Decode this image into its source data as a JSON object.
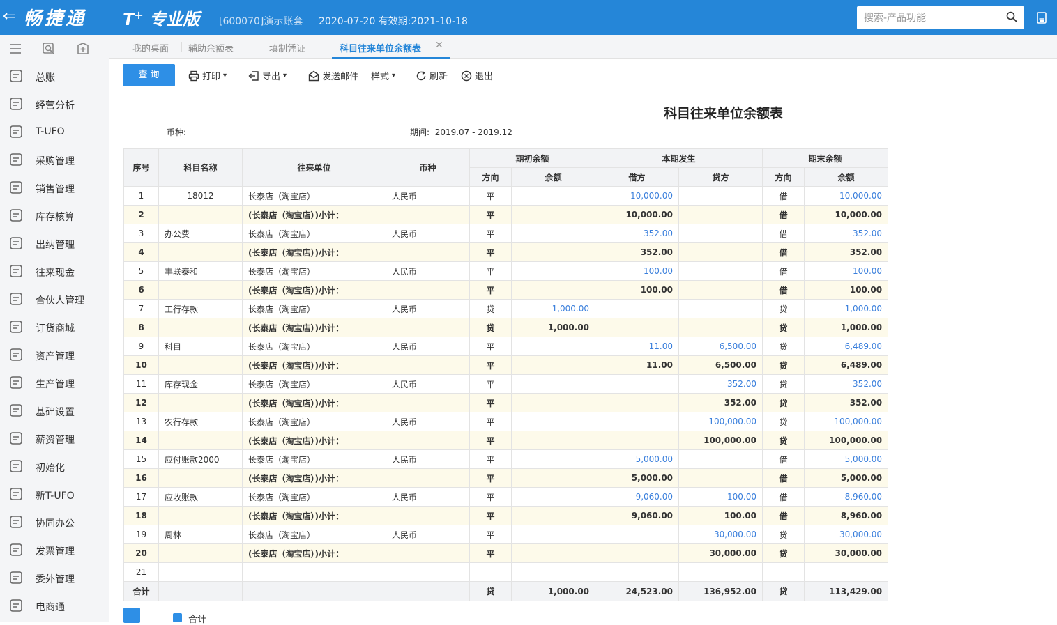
{
  "app": {
    "back": "⇐",
    "logo": "畅捷通",
    "product": "T",
    "product_sup": "+",
    "product_name": "专业版",
    "account": "[600070]演示账套",
    "date_info": "2020-07-20   有效期:2021-10-18",
    "search_placeholder": "搜索-产品功能"
  },
  "sidebar": {
    "items": [
      {
        "label": "总账",
        "icon": "ledger-icon"
      },
      {
        "label": "经营分析",
        "icon": "analysis-icon"
      },
      {
        "label": "T-UFO",
        "icon": "ufo-icon"
      },
      {
        "label": "采购管理",
        "icon": "purchase-icon"
      },
      {
        "label": "销售管理",
        "icon": "sales-icon"
      },
      {
        "label": "库存核算",
        "icon": "inventory-icon"
      },
      {
        "label": "出纳管理",
        "icon": "cashier-icon"
      },
      {
        "label": "往来现金",
        "icon": "transfer-icon"
      },
      {
        "label": "合伙人管理",
        "icon": "partner-icon"
      },
      {
        "label": "订货商城",
        "icon": "store-icon"
      },
      {
        "label": "资产管理",
        "icon": "asset-icon"
      },
      {
        "label": "生产管理",
        "icon": "production-icon"
      },
      {
        "label": "基础设置",
        "icon": "settings-icon"
      },
      {
        "label": "薪资管理",
        "icon": "salary-icon"
      },
      {
        "label": "初始化",
        "icon": "init-icon"
      },
      {
        "label": "新T-UFO",
        "icon": "new-ufo-icon"
      },
      {
        "label": "协同办公",
        "icon": "office-icon"
      },
      {
        "label": "发票管理",
        "icon": "invoice-icon"
      },
      {
        "label": "委外管理",
        "icon": "outsource-icon"
      },
      {
        "label": "电商通",
        "icon": "ecommerce-icon"
      }
    ]
  },
  "tabs": [
    {
      "label": "我的桌面"
    },
    {
      "label": "辅助余额表"
    },
    {
      "label": "填制凭证"
    },
    {
      "label": "科目往来单位余额表"
    }
  ],
  "toolbar": {
    "query": "查 询",
    "print": "打印",
    "export": "导出",
    "email": "发送邮件",
    "style": "样式",
    "refresh": "刷新",
    "exit": "退出"
  },
  "report": {
    "title": "科目往来单位余额表",
    "currency_label": "币种:",
    "period_label": "期间:",
    "period_value": "2019.07 - 2019.12"
  },
  "table": {
    "h": {
      "seq": "序号",
      "account": "科目名称",
      "unit": "往来单位",
      "currency": "币种",
      "opening": "期初余额",
      "current": "本期发生",
      "closing": "期末余额",
      "dir": "方向",
      "bal": "余额",
      "debit": "借方",
      "credit": "贷方"
    },
    "rows": [
      {
        "seq": "1",
        "account": "18012",
        "unit": "长泰店（淘宝店）",
        "cur": "人民币",
        "od": "平",
        "ob": "",
        "dr": "10,000.00",
        "cr": "",
        "cd": "借",
        "cb": "10,000.00",
        "sub": false
      },
      {
        "seq": "2",
        "account": "",
        "unit": "(长泰店（淘宝店）)小计：",
        "cur": "",
        "od": "平",
        "ob": "",
        "dr": "10,000.00",
        "cr": "",
        "cd": "借",
        "cb": "10,000.00",
        "sub": true
      },
      {
        "seq": "3",
        "account": "办公费",
        "unit": "长泰店（淘宝店）",
        "cur": "人民币",
        "od": "平",
        "ob": "",
        "dr": "352.00",
        "cr": "",
        "cd": "借",
        "cb": "352.00",
        "sub": false
      },
      {
        "seq": "4",
        "account": "",
        "unit": "(长泰店（淘宝店）)小计：",
        "cur": "",
        "od": "平",
        "ob": "",
        "dr": "352.00",
        "cr": "",
        "cd": "借",
        "cb": "352.00",
        "sub": true
      },
      {
        "seq": "5",
        "account": "丰联泰和",
        "unit": "长泰店（淘宝店）",
        "cur": "人民币",
        "od": "平",
        "ob": "",
        "dr": "100.00",
        "cr": "",
        "cd": "借",
        "cb": "100.00",
        "sub": false
      },
      {
        "seq": "6",
        "account": "",
        "unit": "(长泰店（淘宝店）)小计：",
        "cur": "",
        "od": "平",
        "ob": "",
        "dr": "100.00",
        "cr": "",
        "cd": "借",
        "cb": "100.00",
        "sub": true
      },
      {
        "seq": "7",
        "account": "工行存款",
        "unit": "长泰店（淘宝店）",
        "cur": "人民币",
        "od": "贷",
        "ob": "1,000.00",
        "dr": "",
        "cr": "",
        "cd": "贷",
        "cb": "1,000.00",
        "sub": false
      },
      {
        "seq": "8",
        "account": "",
        "unit": "(长泰店（淘宝店）)小计：",
        "cur": "",
        "od": "贷",
        "ob": "1,000.00",
        "dr": "",
        "cr": "",
        "cd": "贷",
        "cb": "1,000.00",
        "sub": true
      },
      {
        "seq": "9",
        "account": "科目",
        "unit": "长泰店（淘宝店）",
        "cur": "人民币",
        "od": "平",
        "ob": "",
        "dr": "11.00",
        "cr": "6,500.00",
        "cd": "贷",
        "cb": "6,489.00",
        "sub": false
      },
      {
        "seq": "10",
        "account": "",
        "unit": "(长泰店（淘宝店）)小计：",
        "cur": "",
        "od": "平",
        "ob": "",
        "dr": "11.00",
        "cr": "6,500.00",
        "cd": "贷",
        "cb": "6,489.00",
        "sub": true
      },
      {
        "seq": "11",
        "account": "库存现金",
        "unit": "长泰店（淘宝店）",
        "cur": "人民币",
        "od": "平",
        "ob": "",
        "dr": "",
        "cr": "352.00",
        "cd": "贷",
        "cb": "352.00",
        "sub": false
      },
      {
        "seq": "12",
        "account": "",
        "unit": "(长泰店（淘宝店）)小计：",
        "cur": "",
        "od": "平",
        "ob": "",
        "dr": "",
        "cr": "352.00",
        "cd": "贷",
        "cb": "352.00",
        "sub": true
      },
      {
        "seq": "13",
        "account": "农行存款",
        "unit": "长泰店（淘宝店）",
        "cur": "人民币",
        "od": "平",
        "ob": "",
        "dr": "",
        "cr": "100,000.00",
        "cd": "贷",
        "cb": "100,000.00",
        "sub": false
      },
      {
        "seq": "14",
        "account": "",
        "unit": "(长泰店（淘宝店）)小计：",
        "cur": "",
        "od": "平",
        "ob": "",
        "dr": "",
        "cr": "100,000.00",
        "cd": "贷",
        "cb": "100,000.00",
        "sub": true
      },
      {
        "seq": "15",
        "account": "应付账款2000",
        "unit": "长泰店（淘宝店）",
        "cur": "人民币",
        "od": "平",
        "ob": "",
        "dr": "5,000.00",
        "cr": "",
        "cd": "借",
        "cb": "5,000.00",
        "sub": false
      },
      {
        "seq": "16",
        "account": "",
        "unit": "(长泰店（淘宝店）)小计：",
        "cur": "",
        "od": "平",
        "ob": "",
        "dr": "5,000.00",
        "cr": "",
        "cd": "借",
        "cb": "5,000.00",
        "sub": true
      },
      {
        "seq": "17",
        "account": "应收账款",
        "unit": "长泰店（淘宝店）",
        "cur": "人民币",
        "od": "平",
        "ob": "",
        "dr": "9,060.00",
        "cr": "100.00",
        "cd": "借",
        "cb": "8,960.00",
        "sub": false
      },
      {
        "seq": "18",
        "account": "",
        "unit": "(长泰店（淘宝店）)小计：",
        "cur": "",
        "od": "平",
        "ob": "",
        "dr": "9,060.00",
        "cr": "100.00",
        "cd": "借",
        "cb": "8,960.00",
        "sub": true
      },
      {
        "seq": "19",
        "account": "周林",
        "unit": "长泰店（淘宝店）",
        "cur": "人民币",
        "od": "平",
        "ob": "",
        "dr": "",
        "cr": "30,000.00",
        "cd": "贷",
        "cb": "30,000.00",
        "sub": false
      },
      {
        "seq": "20",
        "account": "",
        "unit": "(长泰店（淘宝店）)小计：",
        "cur": "",
        "od": "平",
        "ob": "",
        "dr": "",
        "cr": "30,000.00",
        "cd": "贷",
        "cb": "30,000.00",
        "sub": true
      },
      {
        "seq": "21",
        "account": "",
        "unit": "",
        "cur": "",
        "od": "",
        "ob": "",
        "dr": "",
        "cr": "",
        "cd": "",
        "cb": "",
        "sub": false
      }
    ],
    "total": {
      "label": "合计",
      "od": "贷",
      "ob": "1,000.00",
      "dr": "24,523.00",
      "cr": "136,952.00",
      "cd": "贷",
      "cb": "113,429.00"
    }
  },
  "footer": {
    "sum_checkbox_label": "合计",
    "sum_checked": true
  }
}
